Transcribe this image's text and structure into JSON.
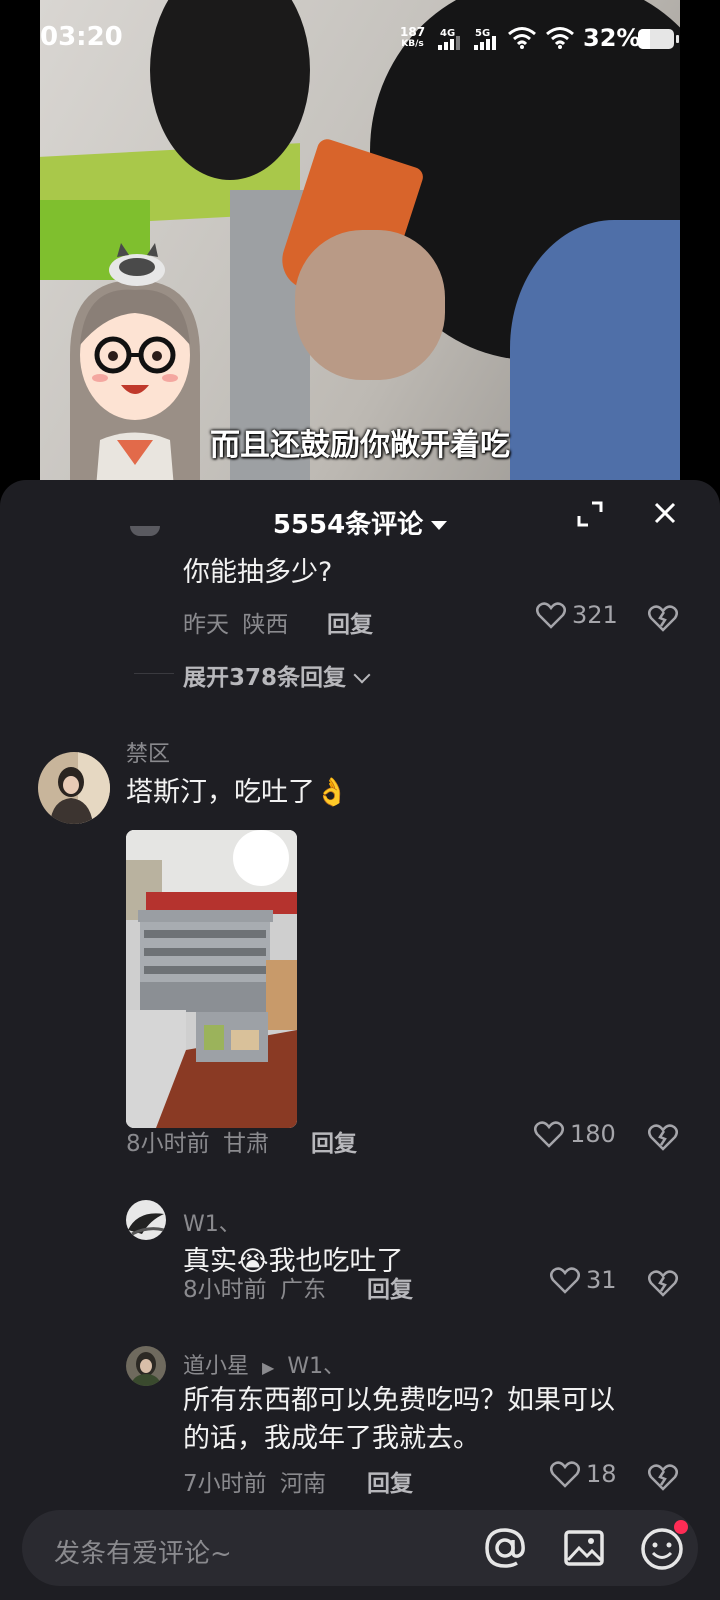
{
  "status_bar": {
    "time": "03:20",
    "net_speed_value": "187",
    "net_speed_unit": "KB/s",
    "sig1_label": "4G",
    "sig2_label": "5G",
    "battery": "32%",
    "battery_level": 0.32
  },
  "video": {
    "subtitle": "而且还鼓励你敞开着吃"
  },
  "sheet": {
    "title": "5554条评论"
  },
  "comments": {
    "c0": {
      "text": "你能抽多少?",
      "time": "昨天",
      "location": "陕西",
      "reply": "回复",
      "likes": "321",
      "expand": "展开378条回复"
    },
    "c1": {
      "name": "禁区",
      "text": "塔斯汀，吃吐了",
      "emoji": "👌",
      "time": "8小时前",
      "location": "甘肃",
      "reply": "回复",
      "likes": "180"
    },
    "r1": {
      "name": "W1、",
      "text_a": "真实",
      "emoji": "😭",
      "text_b": "我也吃吐了",
      "time": "8小时前",
      "location": "广东",
      "reply": "回复",
      "likes": "31"
    },
    "r2": {
      "name": "道小星",
      "reply_to": "W1、",
      "text_line1": "所有东西都可以免费吃吗？如果可以",
      "text_line2": "的话，我成年了我就去。",
      "time": "7小时前",
      "location": "河南",
      "reply": "回复",
      "likes": "18"
    }
  },
  "input": {
    "placeholder": "发条有爱评论~"
  },
  "colors": {
    "sheet_bg": "#1e1e23",
    "accent_red": "#fe2c55"
  }
}
